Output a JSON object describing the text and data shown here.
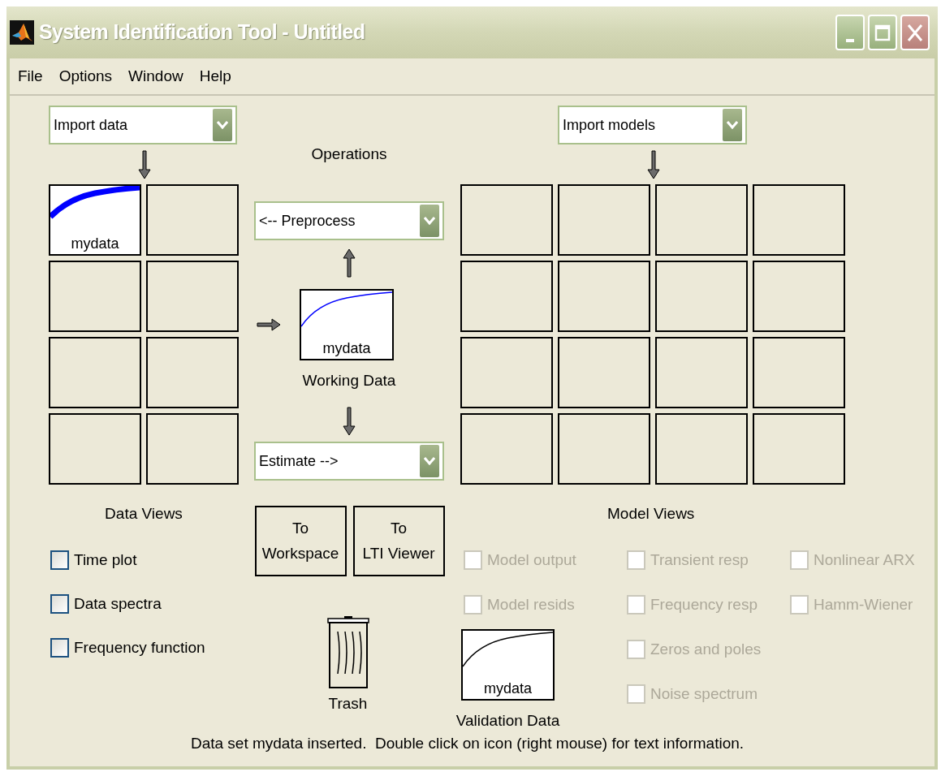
{
  "window": {
    "title": "System Identification Tool - Untitled"
  },
  "menu": [
    "File",
    "Options",
    "Window",
    "Help"
  ],
  "data": {
    "import_dropdown": "Import data",
    "boards": [
      {
        "kind": "data",
        "label": "mydata"
      },
      {
        "kind": "empty"
      },
      {
        "kind": "empty"
      },
      {
        "kind": "empty"
      },
      {
        "kind": "empty"
      },
      {
        "kind": "empty"
      },
      {
        "kind": "empty"
      },
      {
        "kind": "empty"
      }
    ]
  },
  "operations": {
    "title": "Operations",
    "preprocess": "<-- Preprocess",
    "working_data": {
      "label": "mydata"
    },
    "working_data_caption": "Working Data",
    "estimate": "Estimate -->",
    "buttons": [
      "To\nWorkspace",
      "To\nLTI Viewer"
    ]
  },
  "models": {
    "import_dropdown": "Import models",
    "boards": [
      {
        "kind": "empty"
      },
      {
        "kind": "empty"
      },
      {
        "kind": "empty"
      },
      {
        "kind": "empty"
      },
      {
        "kind": "empty"
      },
      {
        "kind": "empty"
      },
      {
        "kind": "empty"
      },
      {
        "kind": "empty"
      },
      {
        "kind": "empty"
      },
      {
        "kind": "empty"
      },
      {
        "kind": "empty"
      },
      {
        "kind": "empty"
      },
      {
        "kind": "empty"
      },
      {
        "kind": "empty"
      },
      {
        "kind": "empty"
      },
      {
        "kind": "empty"
      }
    ]
  },
  "data_views": {
    "title": "Data Views",
    "checkboxes": [
      {
        "label": "Time plot",
        "checked": false,
        "disabled": false
      },
      {
        "label": "Data spectra",
        "checked": false,
        "disabled": false
      },
      {
        "label": "Frequency function",
        "checked": false,
        "disabled": false
      }
    ]
  },
  "trash": {
    "label": "Trash"
  },
  "model_views": {
    "title": "Model Views",
    "columns": [
      [
        {
          "label": "Model output",
          "checked": false,
          "disabled": true
        },
        {
          "label": "Model resids",
          "checked": false,
          "disabled": true
        }
      ],
      [
        {
          "label": "Transient resp",
          "checked": false,
          "disabled": true
        },
        {
          "label": "Frequency resp",
          "checked": false,
          "disabled": true
        },
        {
          "label": "Zeros and poles",
          "checked": false,
          "disabled": true
        },
        {
          "label": "Noise spectrum",
          "checked": false,
          "disabled": true
        }
      ],
      [
        {
          "label": "Nonlinear ARX",
          "checked": false,
          "disabled": true
        },
        {
          "label": "Hamm-Wiener",
          "checked": false,
          "disabled": true
        }
      ]
    ]
  },
  "validation": {
    "label": "mydata",
    "caption": "Validation Data"
  },
  "status": "Data set mydata inserted.  Double click on icon (right mouse) for text information."
}
